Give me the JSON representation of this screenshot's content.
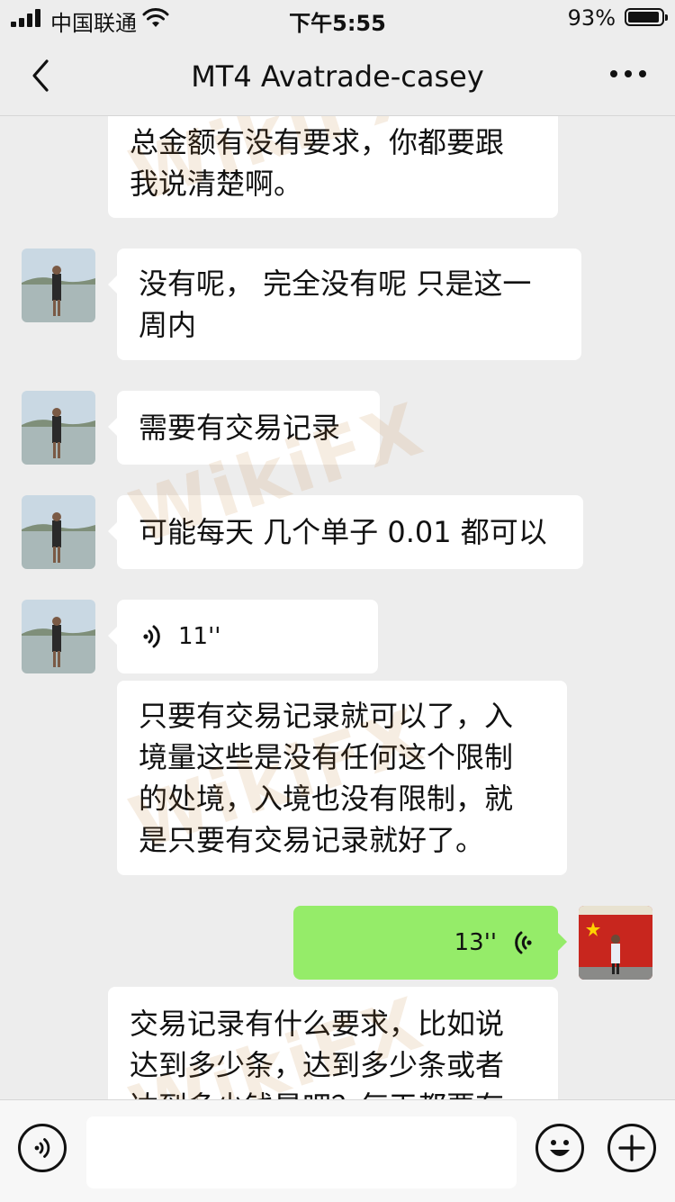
{
  "status_bar": {
    "carrier": "中国联通",
    "time": "下午5:55",
    "battery_percent": "93%",
    "battery_level": 0.93
  },
  "nav": {
    "title": "MT4 Avatrade-casey",
    "back_icon": "chevron-left-icon",
    "more_icon": "more-dots-icon"
  },
  "messages": [
    {
      "sender": "self",
      "type": "text",
      "lines": [
        "总金额有没有要求，你都要跟",
        "我说清楚啊。"
      ]
    },
    {
      "sender": "contact",
      "type": "text",
      "lines": [
        "没有呢，  完全没有呢 只是这一",
        "周内"
      ]
    },
    {
      "sender": "contact",
      "type": "text",
      "lines": [
        "需要有交易记录"
      ]
    },
    {
      "sender": "contact",
      "type": "text",
      "lines": [
        "可能每天 几个单子 0.01 都可以"
      ]
    },
    {
      "sender": "contact",
      "type": "voice",
      "duration": "11''"
    },
    {
      "sender": "contact",
      "type": "text",
      "lines": [
        "只要有交易记录就可以了，入",
        "境量这些是没有任何这个限制",
        "的处境，入境也没有限制，就",
        "是只要有交易记录就好了。"
      ]
    },
    {
      "sender": "self",
      "type": "voice",
      "duration": "13''"
    },
    {
      "sender": "self",
      "type": "text",
      "lines": [
        "交易记录有什么要求，比如说",
        "达到多少条，达到多少条或者",
        "达到多少钱是吧？每天都要有"
      ]
    }
  ],
  "watermark": "WikiFX",
  "colors": {
    "background": "#ededed",
    "bubble_white": "#ffffff",
    "bubble_green": "#95ec69",
    "watermark": "#c0782c"
  },
  "input_bar": {
    "voice_icon": "voice-input-icon",
    "emoji_icon": "emoji-icon",
    "add_icon": "plus-icon",
    "text": ""
  }
}
